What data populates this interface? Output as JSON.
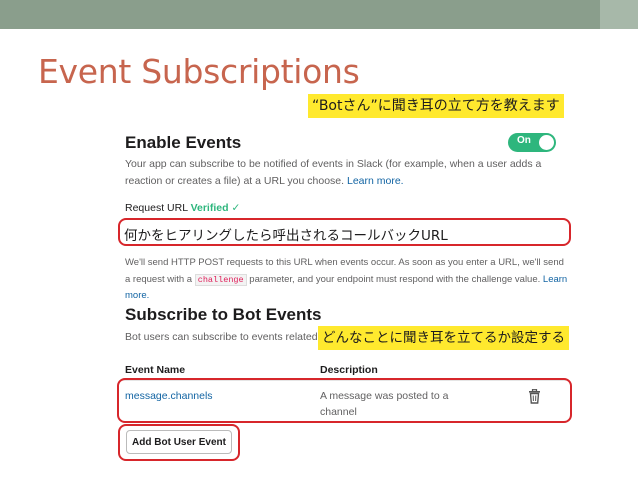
{
  "slide": {
    "title": "Event Subscriptions"
  },
  "callouts": {
    "top": "“Botさん”に聞き耳の立て方を教えます",
    "url": "何かをヒアリングしたら呼出されるコールバックURL",
    "events": "どんなことに聞き耳を立てるか設定する"
  },
  "enable": {
    "heading": "Enable Events",
    "toggle_label": "On",
    "desc_line1": "Your app can subscribe to be notified of events in Slack (for example, when a user adds a",
    "desc_line2_pre": "reaction or creates a file) at a URL you choose. ",
    "learn_more": "Learn more."
  },
  "request_url": {
    "label": "Request URL",
    "status": "Verified",
    "check": "✓"
  },
  "post_info": {
    "line1": "We'll send HTTP POST requests to this URL when events occur. As soon as you enter a URL, we'll send",
    "line2_pre": "a request with a ",
    "param": "challenge",
    "line2_post": " parameter, and your endpoint must respond with the challenge value. ",
    "learn": "Learn",
    "more": "more."
  },
  "bot_events": {
    "heading": "Subscribe to Bot Events",
    "desc": "Bot users can subscribe to events related",
    "col_name": "Event Name",
    "col_desc": "Description",
    "rows": [
      {
        "name": "message.channels",
        "desc_line1": "A message was posted to a",
        "desc_line2": "channel"
      }
    ],
    "add_button": "Add Bot User Event"
  }
}
